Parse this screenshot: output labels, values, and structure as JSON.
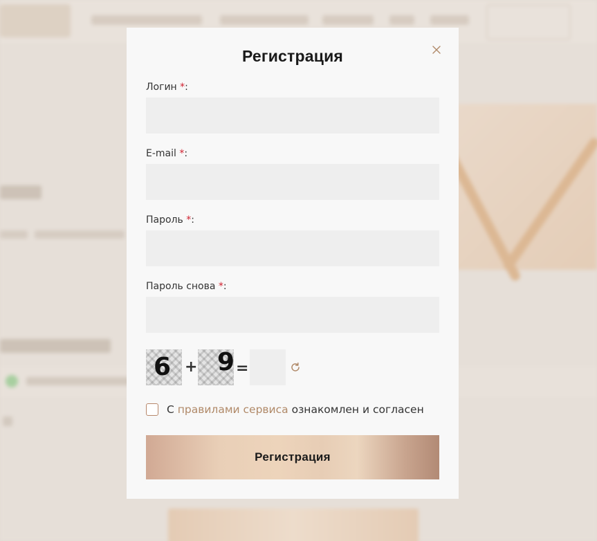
{
  "modal": {
    "title": "Регистрация",
    "close_icon": "close-icon"
  },
  "fields": [
    {
      "label": "Логин",
      "required_mark": "*",
      "colon": ":",
      "value": ""
    },
    {
      "label": "E-mail",
      "required_mark": "*",
      "colon": ":",
      "value": ""
    },
    {
      "label": "Пароль",
      "required_mark": "*",
      "colon": ":",
      "value": ""
    },
    {
      "label": "Пароль снова",
      "required_mark": "*",
      "colon": ":",
      "value": ""
    }
  ],
  "captcha": {
    "digit1": "6",
    "operator": "+",
    "digit2": "9",
    "equals": "=",
    "answer": "",
    "refresh_icon": "refresh-icon"
  },
  "agreement": {
    "prefix": "С ",
    "link_text": "правилами сервиса",
    "suffix": " ознакомлен и согласен",
    "checked": false
  },
  "submit_label": "Регистрация",
  "colors": {
    "required": "#d0202f",
    "link": "#b08968",
    "accent": "#b7876a"
  }
}
